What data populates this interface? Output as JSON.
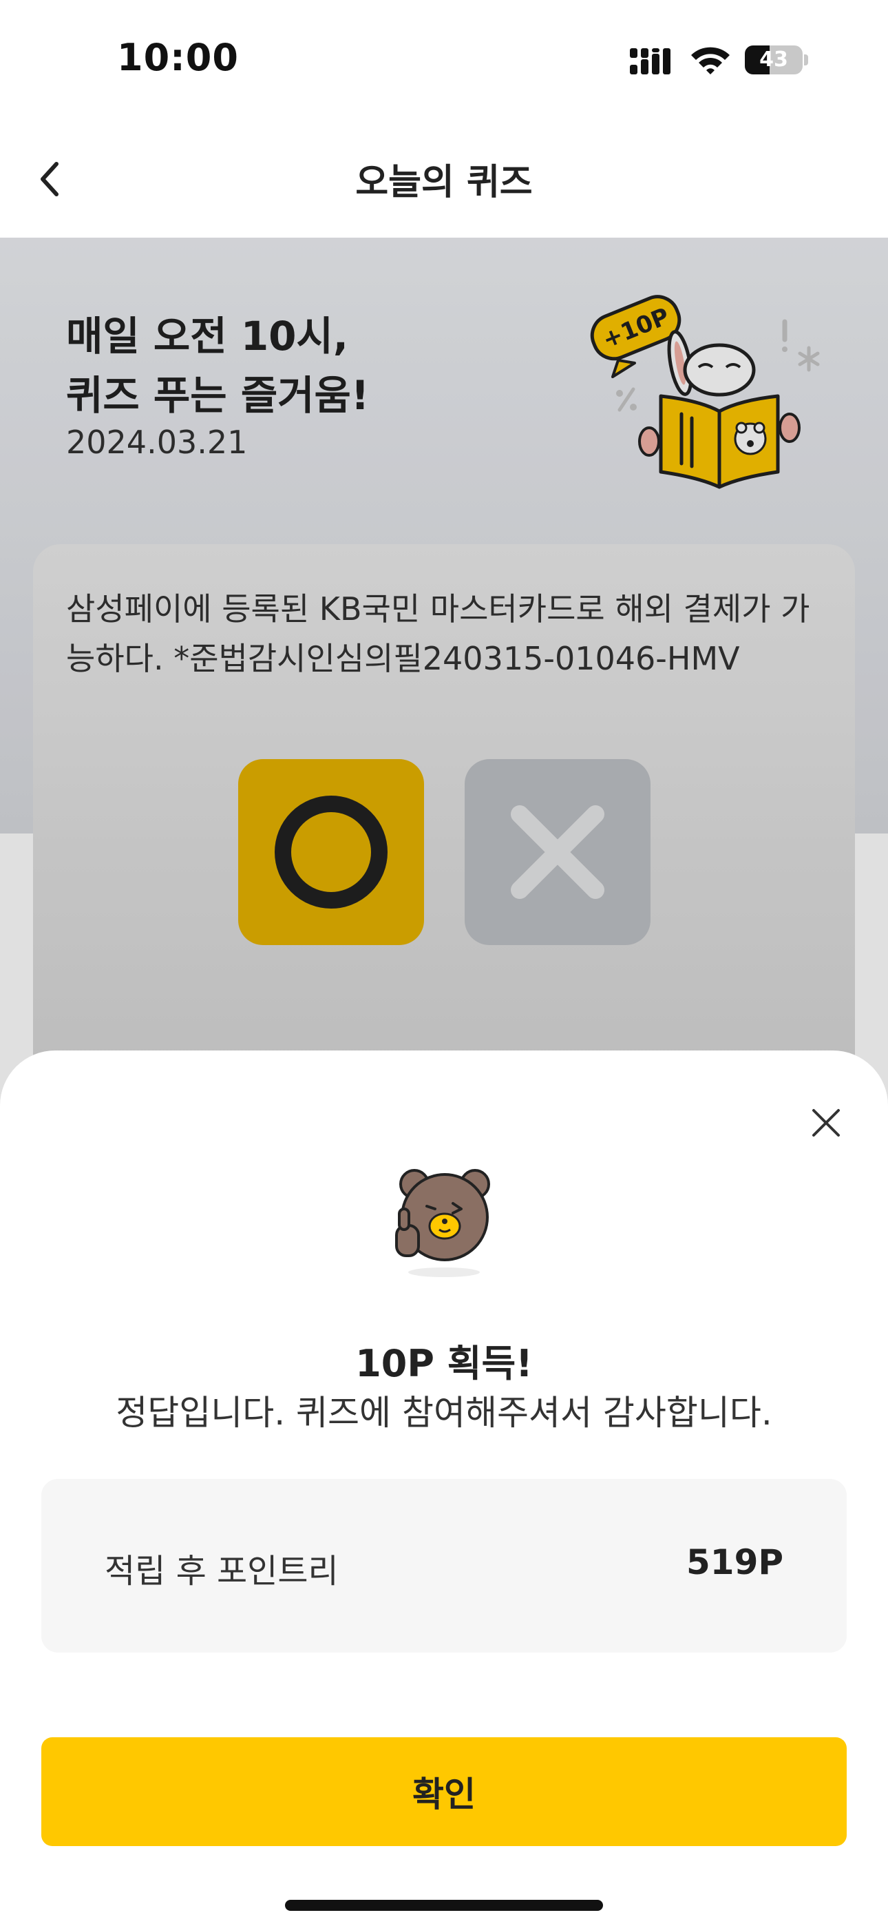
{
  "status_bar": {
    "time": "10:00",
    "battery_level": "43",
    "battery_fraction": 0.43
  },
  "nav": {
    "title": "오늘의 퀴즈"
  },
  "hero": {
    "title": "매일 오전 10시,\n퀴즈 푸는 즐거움!",
    "date": "2024.03.21",
    "badge": "+10P"
  },
  "quiz": {
    "question": "삼성페이에 등록된 KB국민 마스터카드로 해외 결제가 가능하다. *준법감시인심의필240315-01046-HMV",
    "answer_o_color": "#e6b300",
    "answer_x_color": "#bfc2c6"
  },
  "sheet": {
    "title": "10P 획득!",
    "message": "정답입니다. 퀴즈에 참여해주셔서 감사합니다.",
    "points_label": "적립 후 포인트리",
    "points_value": "519P",
    "confirm_label": "확인"
  },
  "colors": {
    "accent": "#ffc800",
    "text": "#222222"
  }
}
